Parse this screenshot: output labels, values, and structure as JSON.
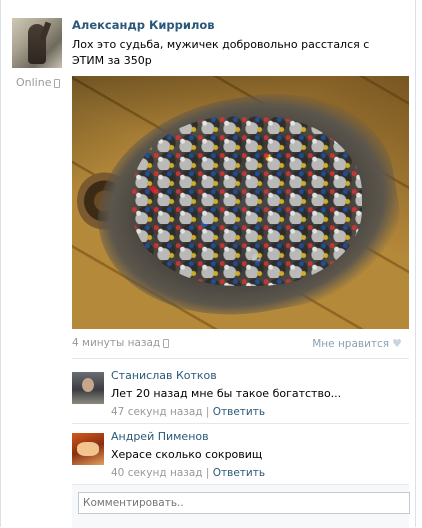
{
  "post": {
    "author": "Александр Киррилов",
    "status": "Online",
    "text": "Лох это судьба, мужичек добровольно расстался с ЭТИМ за 350р",
    "time": "4 минуты назад",
    "like_label": "Мне нравится"
  },
  "comments": [
    {
      "author": "Станислав Котков",
      "text": "Лет 20 назад мне бы такое богатство...",
      "time": "47 секунд назад",
      "sep": "|",
      "reply": "Ответить"
    },
    {
      "author": "Андрей Пименов",
      "text": "Херасе сколько сокровищ",
      "time": "40 секунд назад",
      "sep": "|",
      "reply": "Ответить"
    }
  ],
  "comment_form": {
    "placeholder": "Комментировать.."
  },
  "colors": {
    "link": "#2b587a",
    "meta": "#999999",
    "border": "#dae1e8"
  },
  "icons": [
    "mobile-phone-icon",
    "heart-icon"
  ]
}
